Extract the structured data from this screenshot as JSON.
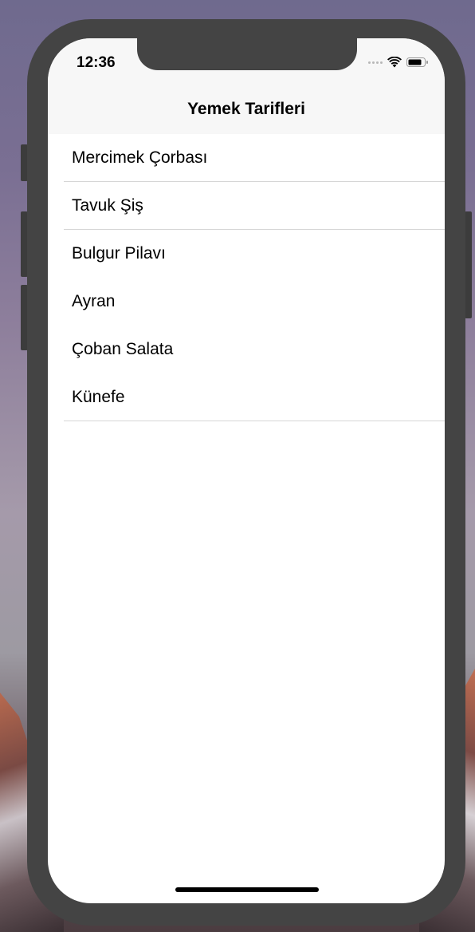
{
  "status_bar": {
    "time": "12:36",
    "icons": [
      "cellular-signal-icon",
      "wifi-icon",
      "battery-icon"
    ]
  },
  "nav": {
    "title": "Yemek Tarifleri"
  },
  "list": {
    "items": [
      {
        "label": "Mercimek Çorbası",
        "separator": true
      },
      {
        "label": "Tavuk Şiş",
        "separator": true
      },
      {
        "label": "Bulgur Pilavı",
        "separator": false
      },
      {
        "label": "Ayran",
        "separator": false
      },
      {
        "label": "Çoban Salata",
        "separator": false
      },
      {
        "label": "Künefe",
        "separator": true
      }
    ]
  },
  "colors": {
    "device_frame": "#444444",
    "bar_background": "#f7f7f7",
    "separator": "#d6d6d6",
    "text": "#000000"
  }
}
